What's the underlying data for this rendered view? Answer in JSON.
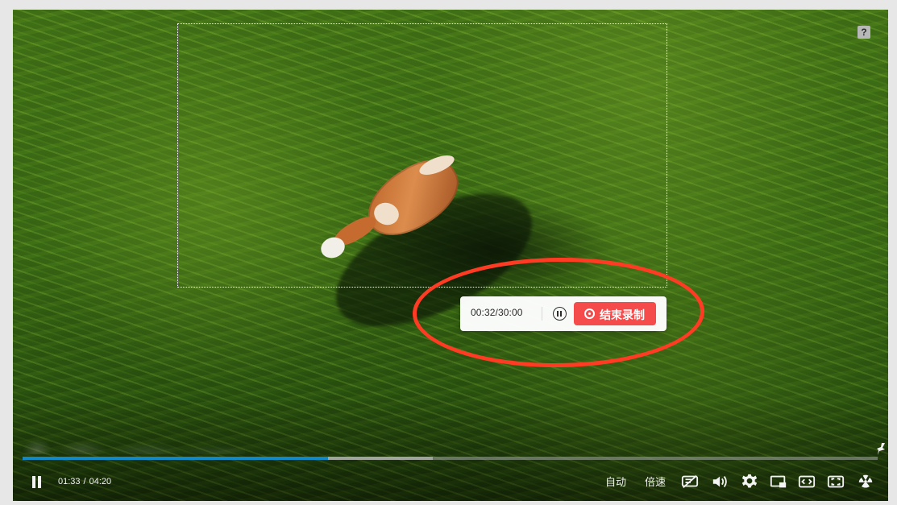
{
  "video": {
    "help_label": "?"
  },
  "recording": {
    "time": "00:32/30:00",
    "stop_label": "结束录制",
    "annotation_color": "#ff3b24",
    "button_color": "#f54b4b"
  },
  "player": {
    "current_time": "01:33",
    "separator": "/",
    "duration": "04:20",
    "progress_fraction": 0.357,
    "buffer_fraction": 0.48,
    "auto_label": "自动",
    "speed_label": "倍速",
    "progress_color": "#1288c4"
  },
  "icons": [
    "help-icon",
    "pause-icon",
    "record-icon",
    "pin-icon",
    "danmaku-off-icon",
    "volume-icon",
    "settings-icon",
    "picture-in-picture-icon",
    "widescreen-icon",
    "fullscreen-icon",
    "radiation-icon"
  ]
}
